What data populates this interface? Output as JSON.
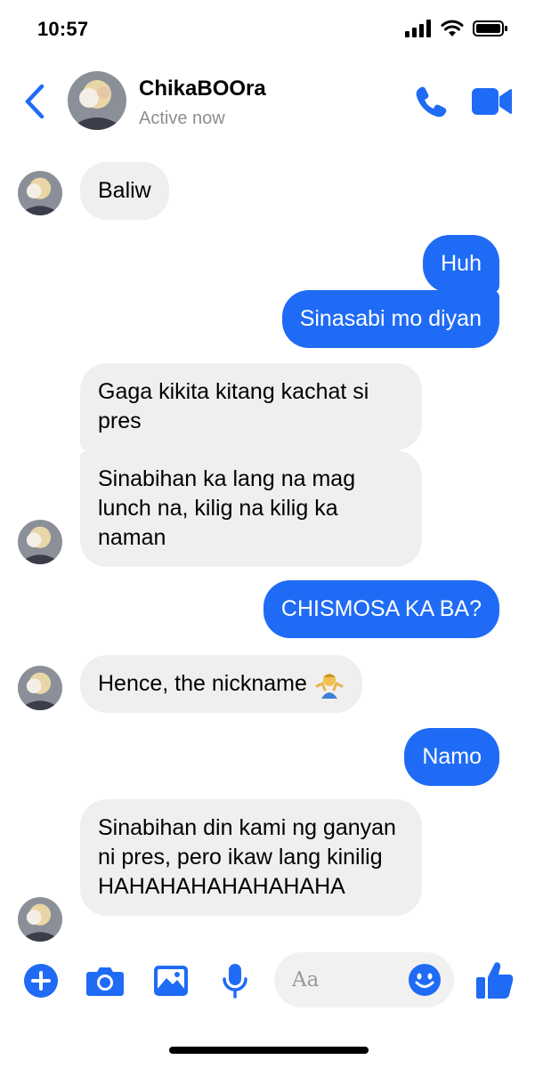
{
  "status_bar": {
    "time": "10:57"
  },
  "header": {
    "contact_name": "ChikaBOOra",
    "contact_status": "Active now"
  },
  "messages": [
    {
      "direction": "incoming",
      "text": "Baliw"
    },
    {
      "direction": "outgoing",
      "text": "Huh"
    },
    {
      "direction": "outgoing",
      "text": "Sinasabi mo diyan"
    },
    {
      "direction": "incoming",
      "text": "Gaga kikita kitang kachat si pres"
    },
    {
      "direction": "incoming",
      "text": "Sinabihan ka lang na mag lunch na, kilig na kilig ka naman"
    },
    {
      "direction": "outgoing",
      "text": "CHISMOSA KA BA?"
    },
    {
      "direction": "incoming",
      "text": "Hence, the nickname",
      "emoji": "man-shrugging"
    },
    {
      "direction": "outgoing",
      "text": "Namo"
    },
    {
      "direction": "incoming",
      "text": "Sinabihan din kami ng ganyan ni pres, pero ikaw lang kinilig HAHAHAHAHAHAHAHA"
    }
  ],
  "composer": {
    "placeholder": "Aa",
    "icons": [
      "plus-icon",
      "camera-icon",
      "image-icon",
      "microphone-icon",
      "emoji-icon",
      "thumbs-up-icon"
    ]
  },
  "colors": {
    "accent": "#1f6bf5",
    "incoming_bubble": "#efefef",
    "secondary_text": "#8e8e93"
  }
}
